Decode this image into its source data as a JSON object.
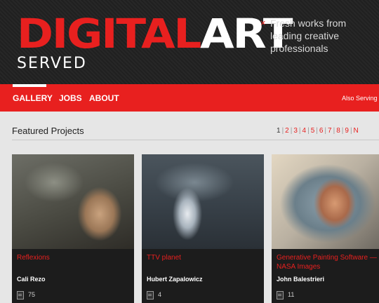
{
  "header": {
    "logo_part1": "DIGITAL",
    "logo_part2": "ART",
    "logo_sub": "SERVED",
    "tagline_bullet": "×",
    "tagline": [
      "Fresh works from",
      "leading creative",
      "professionals"
    ]
  },
  "nav": {
    "items": [
      "GALLERY",
      "JOBS",
      "ABOUT"
    ],
    "active": "GALLERY",
    "also_serving": "Also Serving"
  },
  "section": {
    "title": "Featured Projects",
    "pages": [
      "1",
      "2",
      "3",
      "4",
      "5",
      "6",
      "7",
      "8",
      "9",
      "N"
    ],
    "current_page": "1"
  },
  "projects": [
    {
      "title": "Reflexions",
      "author": "Cali Rezo",
      "count": "75"
    },
    {
      "title": "TTV planet",
      "author": "Hubert Zapalowicz",
      "count": "4"
    },
    {
      "title": "Generative Painting Software — NASA Images",
      "author": "John Balestrieri",
      "count": "11"
    }
  ],
  "colors": {
    "accent": "#e8201f",
    "header_bg": "#202020",
    "card_bg": "#1c1c1c",
    "page_bg": "#e6e6e6"
  }
}
